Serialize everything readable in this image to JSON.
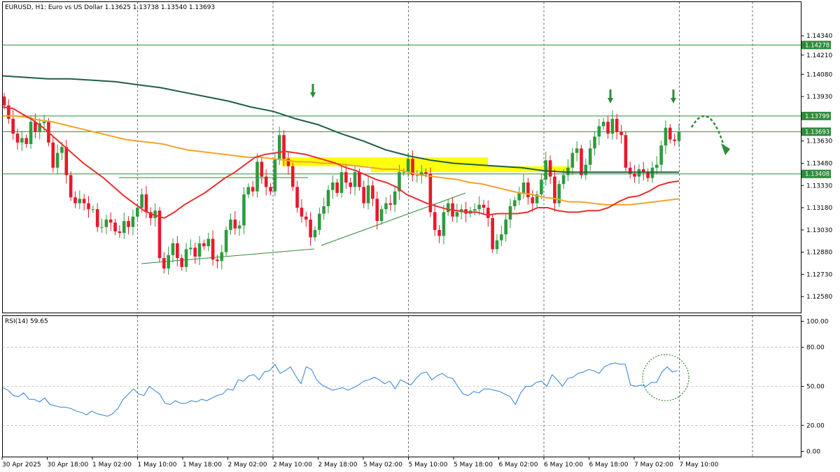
{
  "header": {
    "symbol_line": "EURUSD, H1:  Euro vs US Dollar  1.13625 1.13738 1.13540 1.13693",
    "rsi_label": "RSI(14) 59.65"
  },
  "colors": {
    "bull": "#2e9b3e",
    "bear": "#e8182b",
    "ma_fast": "#e8302f",
    "ma_mid": "#f4a428",
    "ma_slow": "#1f5e47",
    "level": "#2e8b3a",
    "zone": "#ffff00",
    "rsi": "#2f7fd9",
    "signal": "#2e8b3a"
  },
  "chart_data": [
    {
      "type": "candlestick",
      "title": "EURUSD, H1: Euro vs US Dollar",
      "ylim": [
        1.1247,
        1.1457
      ],
      "price_ticks": [
        "1.14340",
        "1.14210",
        "1.14080",
        "1.13930",
        "1.13630",
        "1.13480",
        "1.13330",
        "1.13180",
        "1.13030",
        "1.12880",
        "1.12730",
        "1.12580"
      ],
      "time_labels": [
        "30 Apr 2025",
        "30 Apr 18:00",
        "1 May 02:00",
        "1 May 10:00",
        "1 May 18:00",
        "2 May 02:00",
        "2 May 10:00",
        "2 May 18:00",
        "5 May 02:00",
        "5 May 10:00",
        "5 May 18:00",
        "6 May 02:00",
        "6 May 10:00",
        "6 May 18:00",
        "7 May 02:00",
        "7 May 10:00"
      ],
      "levels": [
        {
          "price": 1.14278,
          "label": "1.14278"
        },
        {
          "price": 1.13799,
          "label": "1.13799"
        },
        {
          "price": 1.13693,
          "label": "1.13693"
        },
        {
          "price": 1.13408,
          "label": "1.13408"
        }
      ],
      "candles": {
        "close": [
          1.1387,
          1.1378,
          1.1368,
          1.1362,
          1.1365,
          1.1361,
          1.1376,
          1.1369,
          1.1375,
          1.1376,
          1.1362,
          1.1345,
          1.1355,
          1.1359,
          1.134,
          1.1325,
          1.1321,
          1.1324,
          1.1321,
          1.1317,
          1.1317,
          1.1305,
          1.1305,
          1.131,
          1.1308,
          1.1302,
          1.1301,
          1.1309,
          1.1305,
          1.1312,
          1.1318,
          1.1327,
          1.1315,
          1.1311,
          1.1316,
          1.1284,
          1.1277,
          1.1286,
          1.1294,
          1.1284,
          1.1278,
          1.129,
          1.1291,
          1.1285,
          1.1294,
          1.1292,
          1.1297,
          1.1283,
          1.1282,
          1.1288,
          1.1303,
          1.131,
          1.1304,
          1.1306,
          1.1327,
          1.1332,
          1.1329,
          1.1349,
          1.1339,
          1.1332,
          1.1329,
          1.1351,
          1.1367,
          1.1351,
          1.1346,
          1.1332,
          1.1318,
          1.1312,
          1.131,
          1.1298,
          1.1303,
          1.1314,
          1.1319,
          1.133,
          1.1335,
          1.1328,
          1.1342,
          1.1335,
          1.1332,
          1.1342,
          1.1332,
          1.1321,
          1.1333,
          1.1324,
          1.1309,
          1.1317,
          1.1321,
          1.132,
          1.1329,
          1.1342,
          1.1342,
          1.1351,
          1.134,
          1.134,
          1.1342,
          1.1341,
          1.1315,
          1.1303,
          1.1299,
          1.1315,
          1.1321,
          1.1312,
          1.1315,
          1.1317,
          1.1314,
          1.1316,
          1.1317,
          1.132,
          1.1318,
          1.1311,
          1.129,
          1.1296,
          1.13,
          1.131,
          1.1319,
          1.1323,
          1.1328,
          1.1335,
          1.1325,
          1.1321,
          1.1327,
          1.1337,
          1.135,
          1.1339,
          1.1321,
          1.1334,
          1.134,
          1.1345,
          1.1355,
          1.1358,
          1.134,
          1.1347,
          1.1358,
          1.1366,
          1.1373,
          1.1376,
          1.1368,
          1.1378,
          1.1369,
          1.1367,
          1.1345,
          1.1341,
          1.1339,
          1.1344,
          1.1342,
          1.1338,
          1.1345,
          1.1347,
          1.136,
          1.1372,
          1.1364,
          1.1363,
          1.1369
        ],
        "open": [
          1.1393,
          1.1387,
          1.1378,
          1.1368,
          1.1362,
          1.1365,
          1.1361,
          1.1376,
          1.1369,
          1.1375,
          1.1376,
          1.1362,
          1.1345,
          1.1355,
          1.1359,
          1.134,
          1.1325,
          1.1321,
          1.1324,
          1.1321,
          1.1317,
          1.1317,
          1.1305,
          1.1305,
          1.131,
          1.1308,
          1.1302,
          1.1301,
          1.1309,
          1.1305,
          1.1312,
          1.1318,
          1.1327,
          1.1315,
          1.1311,
          1.1316,
          1.1284,
          1.1277,
          1.1286,
          1.1294,
          1.1284,
          1.1278,
          1.129,
          1.1291,
          1.1285,
          1.1294,
          1.1292,
          1.1297,
          1.1283,
          1.1282,
          1.1288,
          1.1303,
          1.131,
          1.1304,
          1.1306,
          1.1327,
          1.1332,
          1.1329,
          1.1349,
          1.1339,
          1.1332,
          1.1329,
          1.1351,
          1.1367,
          1.1351,
          1.1346,
          1.1332,
          1.1318,
          1.1312,
          1.131,
          1.1298,
          1.1303,
          1.1314,
          1.1319,
          1.133,
          1.1335,
          1.1328,
          1.1342,
          1.1335,
          1.1332,
          1.1342,
          1.1332,
          1.1321,
          1.1333,
          1.1324,
          1.1309,
          1.1317,
          1.1321,
          1.132,
          1.1329,
          1.1342,
          1.1342,
          1.1351,
          1.134,
          1.134,
          1.1342,
          1.1341,
          1.1315,
          1.1303,
          1.1299,
          1.1315,
          1.1321,
          1.1312,
          1.1315,
          1.1317,
          1.1314,
          1.1316,
          1.1317,
          1.132,
          1.1318,
          1.1311,
          1.129,
          1.1296,
          1.13,
          1.131,
          1.1319,
          1.1323,
          1.1328,
          1.1335,
          1.1325,
          1.1321,
          1.1327,
          1.1337,
          1.135,
          1.1339,
          1.1321,
          1.1334,
          1.134,
          1.1345,
          1.1355,
          1.1358,
          1.134,
          1.1347,
          1.1358,
          1.1366,
          1.1373,
          1.1376,
          1.1368,
          1.1378,
          1.1369,
          1.1367,
          1.1345,
          1.1341,
          1.1339,
          1.1344,
          1.1342,
          1.1338,
          1.1345,
          1.1347,
          1.136,
          1.1372,
          1.1364,
          1.1363
        ]
      },
      "ma_fast": [
        1.1386,
        1.1385,
        1.1381,
        1.1377,
        1.1372,
        1.1366,
        1.136,
        1.1354,
        1.1348,
        1.1343,
        1.1338,
        1.1332,
        1.1326,
        1.1321,
        1.1316,
        1.1313,
        1.1311,
        1.1315,
        1.132,
        1.1324,
        1.1328,
        1.1333,
        1.1338,
        1.1342,
        1.1347,
        1.1352,
        1.1354,
        1.1355,
        1.1356,
        1.1355,
        1.1354,
        1.1352,
        1.135,
        1.1348,
        1.1345,
        1.1343,
        1.134,
        1.1337,
        1.1335,
        1.1332,
        1.1327,
        1.1324,
        1.1321,
        1.1319,
        1.1317,
        1.1316,
        1.1315,
        1.1315,
        1.1313,
        1.1314,
        1.1314,
        1.1314,
        1.1315,
        1.1318,
        1.1318,
        1.1316,
        1.1315,
        1.1315,
        1.1316,
        1.1316,
        1.1318,
        1.1322,
        1.1325,
        1.1326,
        1.1329,
        1.1333,
        1.1335,
        1.1336
      ],
      "ma_mid": [
        1.138,
        1.138,
        1.1379,
        1.1377,
        1.1376,
        1.1374,
        1.1372,
        1.137,
        1.1368,
        1.1366,
        1.1364,
        1.1363,
        1.1362,
        1.1361,
        1.1359,
        1.1357,
        1.1356,
        1.1355,
        1.1354,
        1.1353,
        1.1352,
        1.1352,
        1.1351,
        1.135,
        1.1349,
        1.1349,
        1.1348,
        1.1348,
        1.1347,
        1.1346,
        1.1345,
        1.1344,
        1.1344,
        1.1342,
        1.134,
        1.1339,
        1.1338,
        1.1337,
        1.1335,
        1.1334,
        1.1332,
        1.133,
        1.1328,
        1.1327,
        1.1325,
        1.1324,
        1.1322,
        1.1322,
        1.1321,
        1.132,
        1.132,
        1.132,
        1.1321,
        1.1322,
        1.1323,
        1.1324
      ],
      "ma_slow": [
        1.1407,
        1.1406,
        1.1405,
        1.1405,
        1.1404,
        1.1403,
        1.1401,
        1.1399,
        1.1396,
        1.1393,
        1.139,
        1.1386,
        1.1383,
        1.1378,
        1.1374,
        1.1368,
        1.1363,
        1.1357,
        1.1353,
        1.135,
        1.1348,
        1.1347,
        1.1346,
        1.1345,
        1.1343,
        1.1342,
        1.1342,
        1.1342,
        1.1342,
        1.1342,
        1.1342
      ],
      "resistance_zones": [
        {
          "from": 1.1352,
          "to": 1.1346
        },
        {
          "from": 1.1346,
          "to": 1.1342
        }
      ]
    },
    {
      "type": "line",
      "title": "RSI(14) 59.65",
      "ylim": [
        0,
        100
      ],
      "ticks": [
        "100.00",
        "80.00",
        "50.00",
        "20.00",
        "0.00"
      ],
      "values": [
        49,
        47,
        43,
        42,
        45,
        40,
        40,
        38,
        41,
        36,
        35,
        34,
        34,
        33,
        31,
        30,
        28,
        31,
        29,
        28,
        27,
        29,
        33,
        40,
        44,
        48,
        44,
        43,
        50,
        47,
        44,
        37,
        36,
        39,
        37,
        37,
        39,
        38,
        40,
        39,
        41,
        43,
        44,
        48,
        47,
        55,
        54,
        58,
        59,
        55,
        61,
        62,
        67,
        60,
        62,
        65,
        58,
        52,
        65,
        63,
        55,
        51,
        49,
        47,
        48,
        49,
        47,
        49,
        51,
        54,
        55,
        57,
        55,
        52,
        54,
        48,
        55,
        53,
        51,
        56,
        60,
        61,
        55,
        58,
        60,
        57,
        56,
        50,
        44,
        43,
        46,
        45,
        48,
        48,
        47,
        46,
        44,
        42,
        36,
        45,
        50,
        50,
        53,
        54,
        50,
        59,
        55,
        50,
        56,
        57,
        60,
        61,
        63,
        62,
        60,
        65,
        67,
        68,
        67,
        67,
        51,
        50,
        51,
        50,
        53,
        53,
        61,
        65,
        61,
        62
      ]
    }
  ]
}
